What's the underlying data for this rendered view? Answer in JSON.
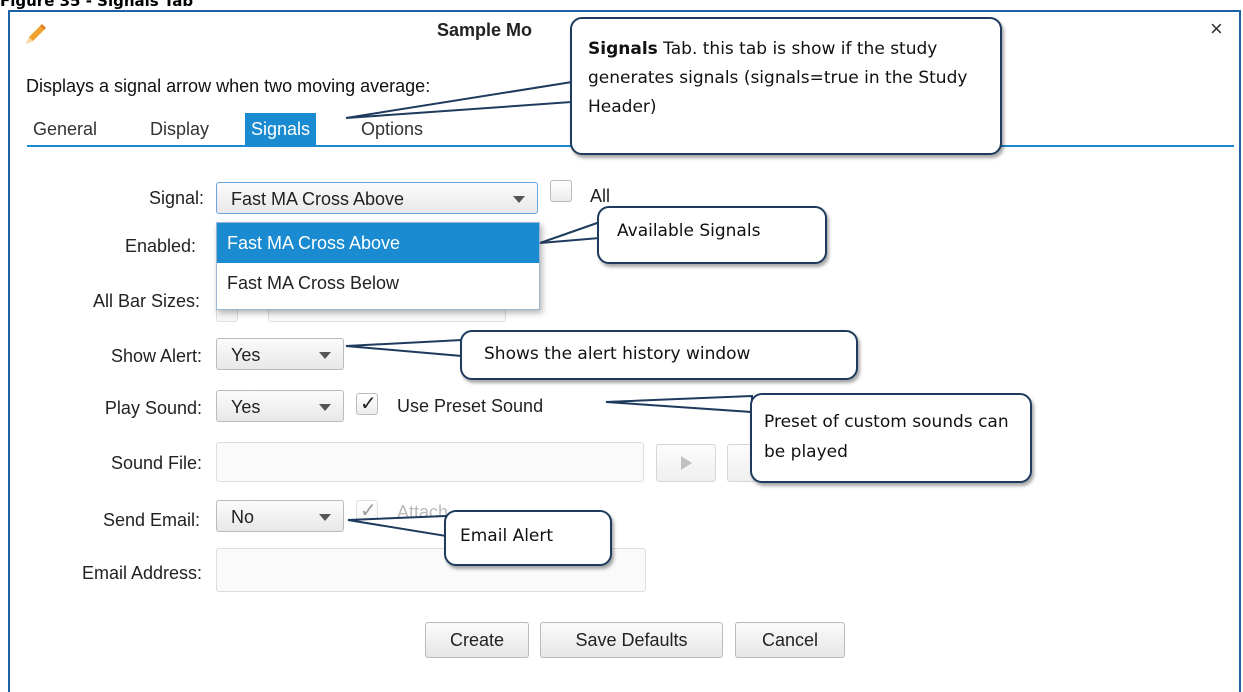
{
  "figure_caption": "Figure 35 - Signals Tab",
  "dialog": {
    "title": "Sample Mo",
    "close_symbol": "×",
    "title_icon": "pencil-icon",
    "description": "Displays a signal arrow when two moving average:",
    "tabs": [
      {
        "label": "General",
        "active": false
      },
      {
        "label": "Display",
        "active": false
      },
      {
        "label": "Signals",
        "active": true
      },
      {
        "label": "Options",
        "active": false
      }
    ]
  },
  "form": {
    "signal_label": "Signal:",
    "signal_value": "Fast MA Cross Above",
    "all_label": "All",
    "enabled_label": "Enabled:",
    "all_bar_sizes_label": "All Bar Sizes:",
    "show_alert_label": "Show Alert:",
    "show_alert_value": "Yes",
    "play_sound_label": "Play Sound:",
    "play_sound_value": "Yes",
    "use_preset_sound_label": "Use Preset Sound",
    "use_preset_sound_checked": true,
    "sound_file_label": "Sound File:",
    "sound_file_value": "",
    "send_email_label": "Send Email:",
    "send_email_value": "No",
    "attach_label": "Attach",
    "email_address_label": "Email Address:",
    "email_address_value": "",
    "dropdown_options": [
      "Fast MA Cross Above",
      "Fast MA Cross Below"
    ],
    "dropdown_selected": "Fast MA Cross Above",
    "play_icon": "play-icon"
  },
  "buttons": {
    "create": "Create",
    "save_defaults": "Save Defaults",
    "cancel": "Cancel"
  },
  "callouts": {
    "signals_tab_bold": "Signals",
    "signals_tab_rest": " Tab.  this tab is show if the study generates signals (signals=true in the Study Header)",
    "available_signals": "Available Signals",
    "shows_alert": "Shows the alert history window",
    "preset_sounds": "Preset of custom sounds can be played",
    "email_alert": "Email Alert"
  },
  "colors": {
    "accent": "#1b8bd1",
    "dialog_border": "#1d62a8",
    "callout_border": "#1e3b5e"
  }
}
